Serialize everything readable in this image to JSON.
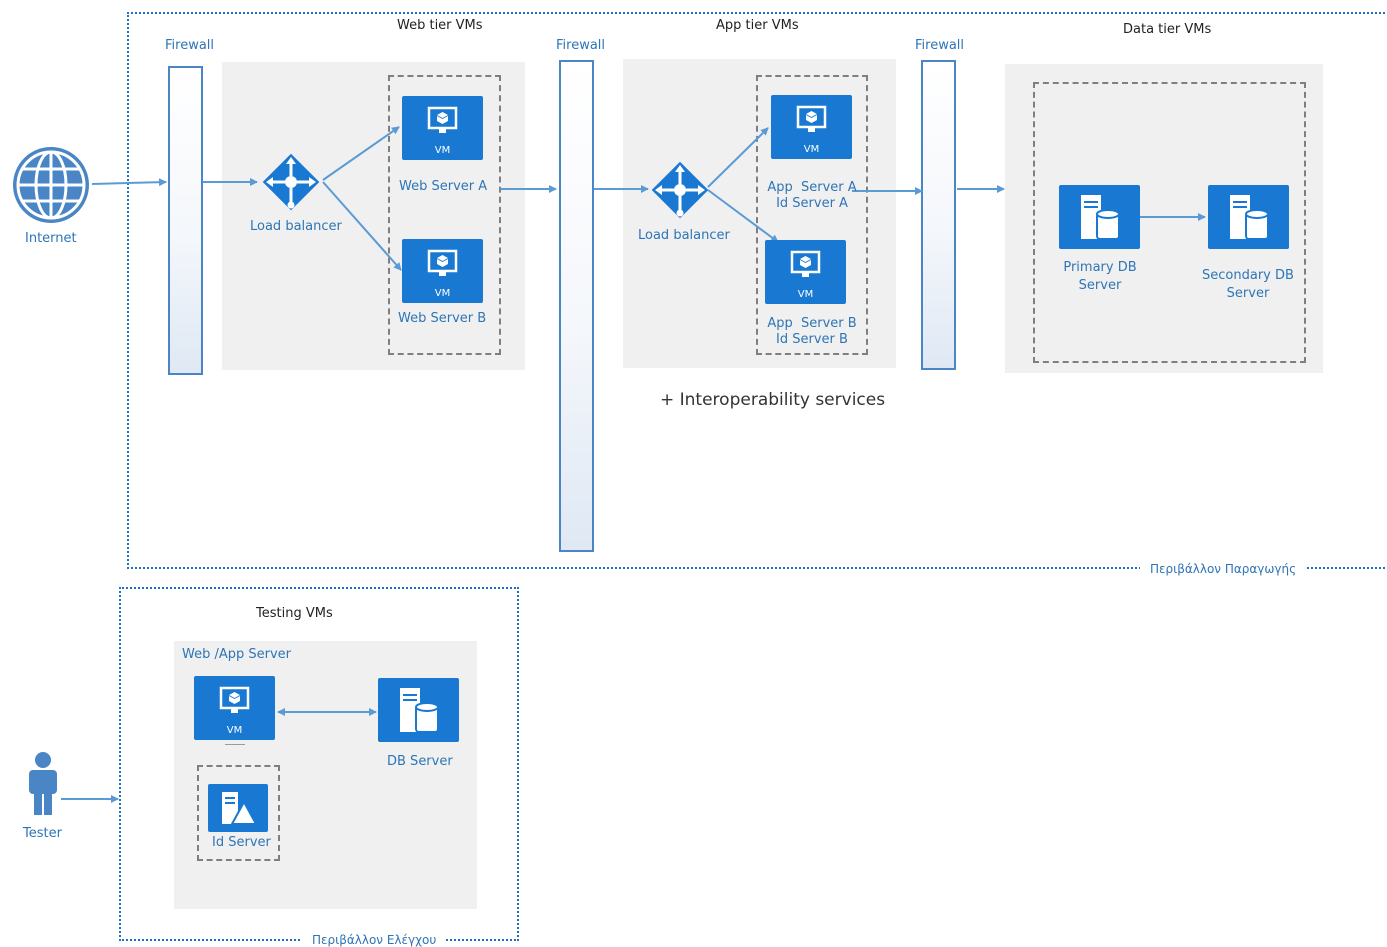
{
  "zones": {
    "production_label": "Περιβάλλον Παραγωγής",
    "testing_label": "Περιβάλλον Ελέγχου"
  },
  "internet": {
    "label": "Internet"
  },
  "tester": {
    "label": "Tester"
  },
  "web_tier": {
    "title": "Web tier VMs",
    "firewall": "Firewall",
    "load_balancer": "Load balancer",
    "servers": [
      "Web Server A",
      "Web Server B"
    ]
  },
  "app_tier": {
    "title": "App tier VMs",
    "firewall": "Firewall",
    "load_balancer": "Load balancer",
    "server_a": [
      "App  Server A",
      "Id Server A"
    ],
    "server_b": [
      "App  Server B",
      "Id Server B"
    ],
    "note": "+ Interoperability services"
  },
  "data_tier": {
    "title": "Data tier VMs",
    "firewall": "Firewall",
    "primary": [
      "Primary DB",
      "Server"
    ],
    "secondary": [
      "Secondary DB",
      "Server"
    ]
  },
  "testing": {
    "title": "Testing VMs",
    "web_app_server": "Web /App Server",
    "db_server": "DB Server",
    "id_server": "Id Server"
  },
  "vm_badge": "VM",
  "colors": {
    "accent": "#1979d2",
    "connector": "#5b9bd5",
    "label": "#2e75b6"
  },
  "icons": [
    "globe-icon",
    "person-icon",
    "load-balancer-icon",
    "vm-icon",
    "db-server-icon",
    "id-server-icon"
  ]
}
